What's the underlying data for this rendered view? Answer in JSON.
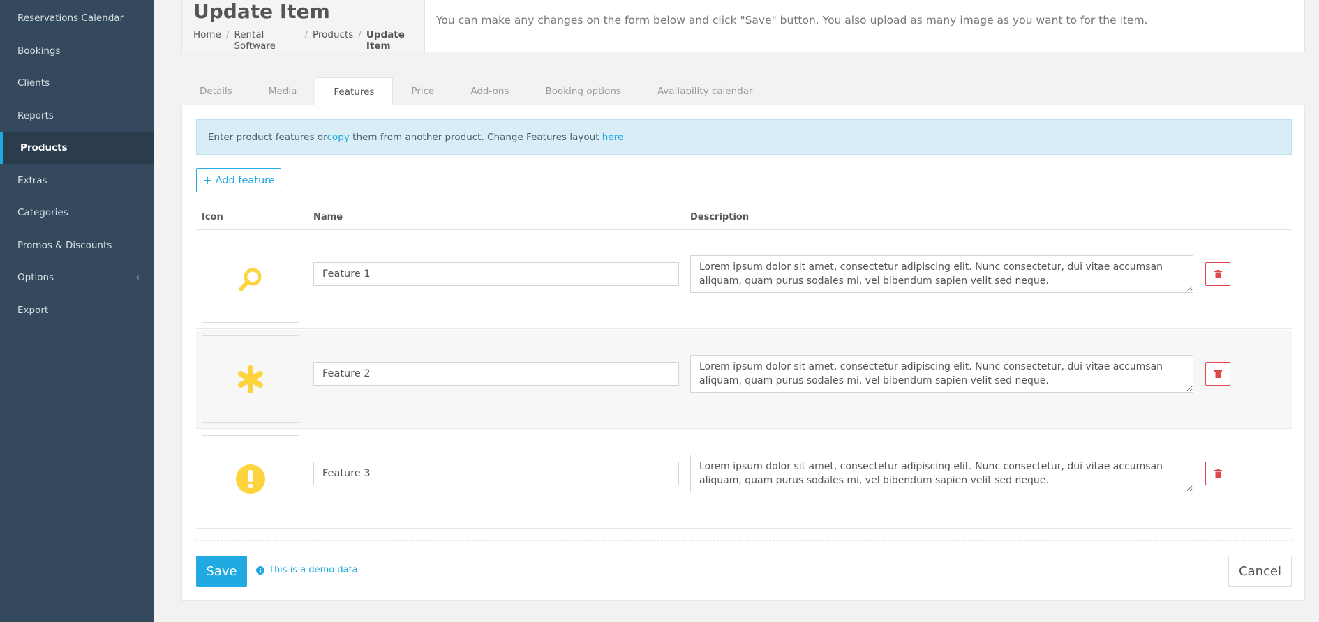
{
  "sidebar": {
    "items": [
      {
        "label": "Reservations Calendar"
      },
      {
        "label": "Bookings"
      },
      {
        "label": "Clients"
      },
      {
        "label": "Reports"
      },
      {
        "label": "Products"
      },
      {
        "label": "Extras"
      },
      {
        "label": "Categories"
      },
      {
        "label": "Promos & Discounts"
      },
      {
        "label": "Options"
      },
      {
        "label": "Export"
      }
    ],
    "active": "Products",
    "options_chevron": "‹"
  },
  "header": {
    "title": "Update Item",
    "breadcrumb": [
      "Home",
      "Rental Software",
      "Products",
      "Update Item"
    ],
    "description": "You can make any changes on the form below and click \"Save\" button. You also upload as many image as you want to for the item."
  },
  "tabs": [
    {
      "label": "Details"
    },
    {
      "label": "Media"
    },
    {
      "label": "Features"
    },
    {
      "label": "Price"
    },
    {
      "label": "Add-ons"
    },
    {
      "label": "Booking options"
    },
    {
      "label": "Availability calendar"
    }
  ],
  "active_tab": "Features",
  "alert": {
    "text_1": "Enter product features or ",
    "link_copy": "copy",
    "text_2": " them from another product. Change Features layout ",
    "link_here": "here"
  },
  "add_feature_label": "Add feature",
  "table": {
    "headers": {
      "icon": "Icon",
      "name": "Name",
      "description": "Description"
    },
    "rows": [
      {
        "icon": "magnifier-icon",
        "name": "Feature 1",
        "description": "Lorem ipsum dolor sit amet, consectetur adipiscing elit. Nunc consectetur, dui vitae accumsan aliquam, quam purus sodales mi, vel bibendum sapien velit sed neque."
      },
      {
        "icon": "asterisk-icon",
        "name": "Feature 2",
        "description": "Lorem ipsum dolor sit amet, consectetur adipiscing elit. Nunc consectetur, dui vitae accumsan aliquam, quam purus sodales mi, vel bibendum sapien velit sed neque."
      },
      {
        "icon": "exclamation-circle-icon",
        "name": "Feature 3",
        "description": "Lorem ipsum dolor sit amet, consectetur adipiscing elit. Nunc consectetur, dui vitae accumsan aliquam, quam purus sodales mi, vel bibendum sapien velit sed neque."
      }
    ]
  },
  "footer": {
    "save_label": "Save",
    "demo_note": "This is a demo data",
    "cancel_label": "Cancel"
  },
  "colors": {
    "accent": "#21a9e1",
    "sidebar_bg": "#34495e",
    "icon_yellow": "#fdd43d",
    "danger": "#e0474c"
  }
}
